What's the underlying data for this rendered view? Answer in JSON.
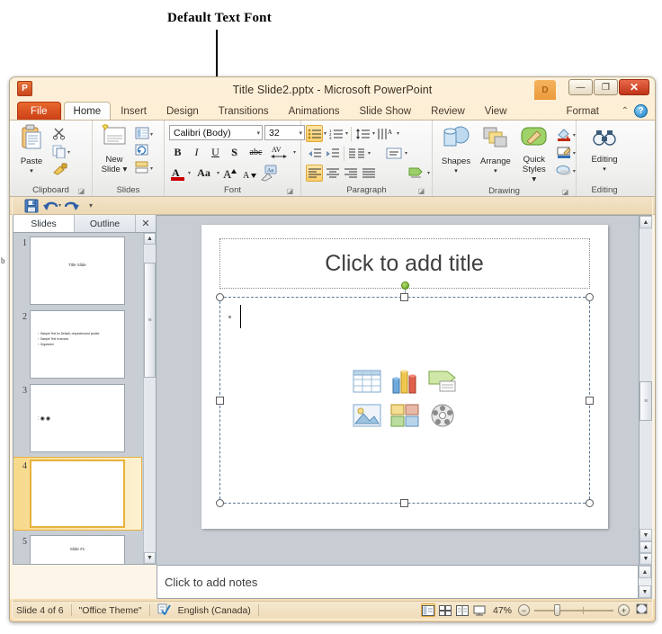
{
  "annotation": {
    "label": "Default Text Font",
    "edge_letter": "b"
  },
  "window": {
    "title": "Title Slide2.pptx  -  Microsoft PowerPoint",
    "logo": "P",
    "minimize": "—",
    "maximize": "❐",
    "close": "✕",
    "contextual_tab_badge": "D"
  },
  "tabs": [
    {
      "label": "File",
      "type": "file"
    },
    {
      "label": "Home",
      "type": "active"
    },
    {
      "label": "Insert",
      "type": "normal"
    },
    {
      "label": "Design",
      "type": "normal"
    },
    {
      "label": "Transitions",
      "type": "normal"
    },
    {
      "label": "Animations",
      "type": "normal"
    },
    {
      "label": "Slide Show",
      "type": "normal"
    },
    {
      "label": "Review",
      "type": "normal"
    },
    {
      "label": "View",
      "type": "normal"
    },
    {
      "label": "Format",
      "type": "contextual"
    }
  ],
  "ribbon_controls": {
    "collapse": "⌃",
    "help": "?"
  },
  "ribbon": {
    "clipboard": {
      "label": "Clipboard",
      "paste": "Paste",
      "paste_arrow": "▾",
      "cut": "✂",
      "copy": "⧉",
      "format_painter": "🖌",
      "dialog": "◪"
    },
    "slides": {
      "label": "Slides",
      "new_slide": "New\nSlide",
      "new_slide_line1": "New",
      "new_slide_line2": "Slide ▾",
      "layout": "Layout",
      "reset": "Reset",
      "section": "Section"
    },
    "font": {
      "label": "Font",
      "font_name": "Calibri (Body)",
      "font_size": "32",
      "bold": "B",
      "italic": "I",
      "underline": "U",
      "shadow": "S",
      "strikethrough": "abc",
      "char_spacing": "AV",
      "font_color": "A",
      "change_case": "Aa",
      "grow_font": "A",
      "shrink_font": "A",
      "clear_formatting": "Aa",
      "dialog": "◪"
    },
    "paragraph": {
      "label": "Paragraph",
      "bullets": "bullets-list",
      "numbering": "numbered-list",
      "decrease_indent": "decrease-indent",
      "increase_indent": "increase-indent",
      "line_spacing": "line-spacing",
      "text_direction": "text-direction",
      "align_text": "align-text",
      "convert_smartart": "convert-to-smartart",
      "columns": "columns",
      "align_left": "align-left",
      "align_center": "align-center",
      "align_right": "align-right",
      "justify": "justify",
      "dialog": "◪"
    },
    "drawing": {
      "label": "Drawing",
      "shapes": "Shapes",
      "arrange": "Arrange",
      "quick_styles_line1": "Quick",
      "quick_styles_line2": "Styles ▾",
      "shape_fill": "shape-fill",
      "shape_outline": "shape-outline",
      "shape_effects": "shape-effects",
      "dialog": "◪"
    },
    "editing": {
      "label": "Editing",
      "button": "Editing",
      "arrow": "▾"
    }
  },
  "quick_access": {
    "save": "save-icon",
    "undo": "undo-icon",
    "undo_arrow": "▾",
    "redo": "redo-icon",
    "customize": "▾"
  },
  "slides_panel": {
    "tabs": [
      {
        "label": "Slides",
        "active": true
      },
      {
        "label": "Outline",
        "active": false
      }
    ],
    "close": "✕",
    "thumbnails": [
      {
        "num": "1",
        "kind": "title",
        "title": "Title Slide",
        "selected": false
      },
      {
        "num": "2",
        "kind": "bullets",
        "bullets": [
          "Sample Text for Default, respected and posted",
          "Sample Text in arrows",
          "Organized"
        ],
        "selected": false
      },
      {
        "num": "3",
        "kind": "tiny",
        "text": ":◉◉",
        "selected": false
      },
      {
        "num": "4",
        "kind": "blank",
        "selected": true
      },
      {
        "num": "5",
        "kind": "footer",
        "text": "Slide #1",
        "selected": false
      }
    ],
    "scroll_up": "▲",
    "scroll_down": "▼",
    "grip": "≡"
  },
  "slide_editor": {
    "title_placeholder": "Click to add title",
    "content_icons": [
      "insert-table-icon",
      "insert-chart-icon",
      "insert-smartart-icon",
      "insert-picture-icon",
      "insert-clipart-icon",
      "insert-media-icon"
    ],
    "scroll_up": "▲",
    "scroll_down": "▼",
    "prev_slide": "▲",
    "next_slide": "▼",
    "grip": "≡"
  },
  "notes": {
    "placeholder": "Click to add notes",
    "scroll_up": "▲",
    "scroll_down": "▼"
  },
  "status_bar": {
    "slide_count": "Slide 4 of 6",
    "theme": "\"Office Theme\"",
    "spellcheck": "spellcheck-icon",
    "language": "English (Canada)",
    "views": [
      {
        "name": "normal-view",
        "active": true
      },
      {
        "name": "slide-sorter-view",
        "active": false
      },
      {
        "name": "reading-view",
        "active": false
      },
      {
        "name": "slide-show-view",
        "active": false
      }
    ],
    "zoom_percent": "47%",
    "zoom_out": "−",
    "zoom_in": "+",
    "fit_to_window": "fit-slide-icon"
  },
  "colors": {
    "file_tab": "#cc3f15",
    "window_chrome": "#f8dcb0",
    "selection_accent": "#e8b13c",
    "close_button": "#c03418",
    "workspace": "#c8cdd3"
  }
}
